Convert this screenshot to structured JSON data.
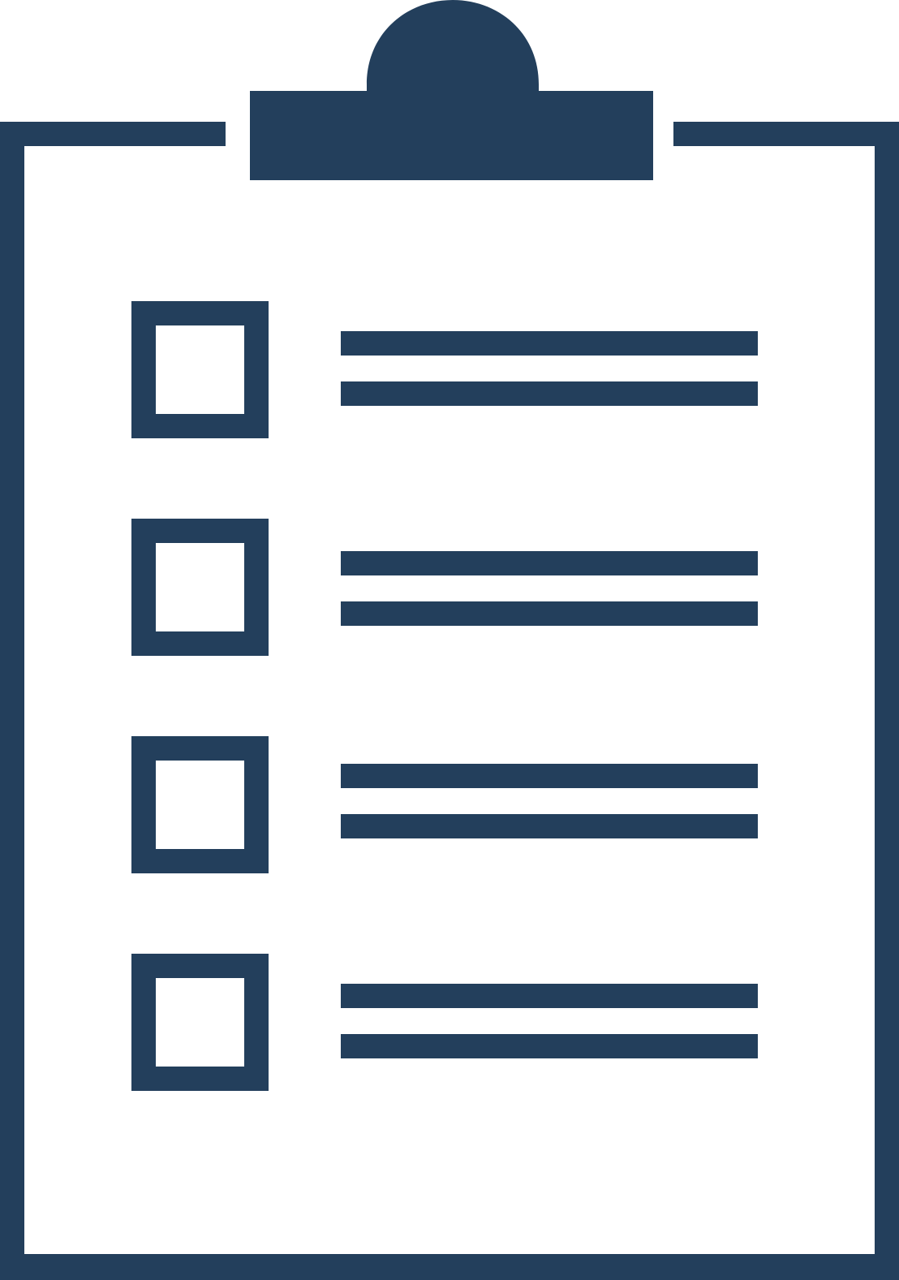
{
  "icon": {
    "name": "clipboard-checklist-icon",
    "color": "#233f5c",
    "background": "#ffffff"
  },
  "checklist": {
    "item_count": 4,
    "lines_per_item": 2,
    "items": [
      {
        "checked": false
      },
      {
        "checked": false
      },
      {
        "checked": false
      },
      {
        "checked": false
      }
    ]
  }
}
